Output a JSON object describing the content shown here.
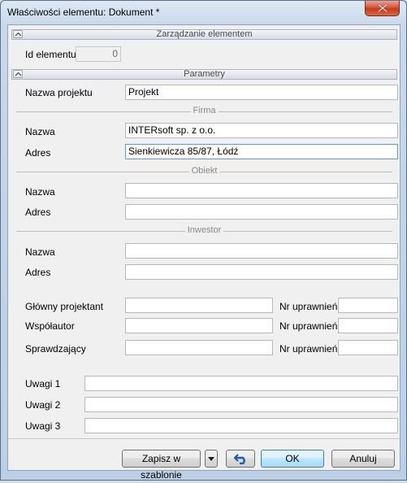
{
  "window": {
    "title": "Właściwości elementu: Dokument *"
  },
  "sections": {
    "management": "Zarządzanie elementem",
    "params": "Parametry"
  },
  "element_id": {
    "label": "Id elementu",
    "value": "0"
  },
  "project": {
    "label": "Nazwa projektu",
    "value": "Projekt"
  },
  "firma": {
    "header": "Firma",
    "name_label": "Nazwa",
    "name_value": "INTERsoft sp. z o.o.",
    "addr_label": "Adres",
    "addr_value": "Sienkiewicza 85/87, Łódź"
  },
  "obiekt": {
    "header": "Obiekt",
    "name_label": "Nazwa",
    "name_value": "",
    "addr_label": "Adres",
    "addr_value": ""
  },
  "inwestor": {
    "header": "Inwestor",
    "name_label": "Nazwa",
    "name_value": "",
    "addr_label": "Adres",
    "addr_value": ""
  },
  "people": [
    {
      "label": "Główny projektant",
      "value": "",
      "perm_label": "Nr uprawnień",
      "perm_value": ""
    },
    {
      "label": "Współautor",
      "value": "",
      "perm_label": "Nr uprawnień",
      "perm_value": ""
    },
    {
      "label": "Sprawdzający",
      "value": "",
      "perm_label": "Nr uprawnień",
      "perm_value": ""
    }
  ],
  "notes": [
    {
      "label": "Uwagi 1",
      "value": ""
    },
    {
      "label": "Uwagi 2",
      "value": ""
    },
    {
      "label": "Uwagi 3",
      "value": ""
    }
  ],
  "buttons": {
    "save_template": "Zapisz w szablonie",
    "ok": "OK",
    "cancel": "Anuluj"
  },
  "icons": {
    "close": "close-icon",
    "collapse": "chevron-up-icon",
    "dropdown": "triangle-down-icon",
    "undo": "undo-arrow-icon"
  }
}
